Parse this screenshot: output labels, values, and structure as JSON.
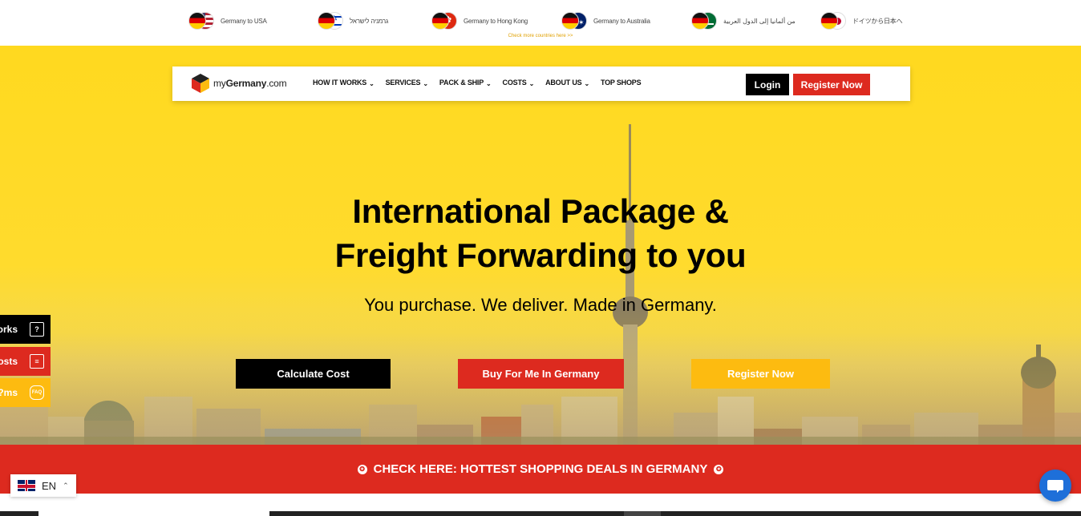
{
  "countries": [
    {
      "label": "Germany to USA",
      "flag": "us"
    },
    {
      "label": "גרמניה לישראל",
      "flag": "il"
    },
    {
      "label": "Germany to Hong Kong",
      "flag": "hk"
    },
    {
      "label": "Germany to Australia",
      "flag": "au"
    },
    {
      "label": "من ألمانيا إلى الدول العربية",
      "flag": "sa"
    },
    {
      "label": "ドイツから日本へ",
      "flag": "jp"
    }
  ],
  "more_countries": "Check more countries here >>",
  "logo": {
    "prefix": "my",
    "brand": "Germany",
    "suffix": ".com"
  },
  "nav": {
    "items": [
      {
        "label": "HOW IT WORKS",
        "dropdown": true
      },
      {
        "label": "SERVICES",
        "dropdown": true
      },
      {
        "label": "PACK & SHIP",
        "dropdown": true
      },
      {
        "label": "COSTS",
        "dropdown": true
      },
      {
        "label": "ABOUT US",
        "dropdown": true
      },
      {
        "label": "TOP SHOPS",
        "dropdown": false
      }
    ],
    "login": "Login",
    "register": "Register Now"
  },
  "hero": {
    "title_line1": "International Package &",
    "title_line2": "Freight Forwarding to you",
    "subtitle": "You purchase. We deliver. Made in Germany.",
    "cta_calculate": "Calculate Cost",
    "cta_buy": "Buy For Me In Germany",
    "cta_register": "Register Now"
  },
  "side_tabs": [
    {
      "label": "orks",
      "icon": "question-book-icon"
    },
    {
      "label": "osts",
      "icon": "price-list-icon"
    },
    {
      "label": "ms?",
      "icon": "faq-icon"
    }
  ],
  "deals_banner": "CHECK HERE: HOTTEST SHOPPING DEALS IN GERMANY",
  "language": {
    "code": "EN"
  },
  "colors": {
    "yellow": "#ffd91f",
    "red": "#dd2a1f",
    "black": "#000000",
    "amber": "#fdbb10",
    "chat_blue": "#1e6fd9"
  }
}
